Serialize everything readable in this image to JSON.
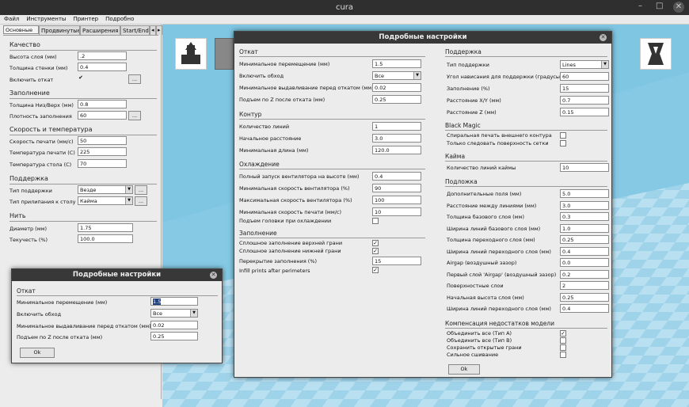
{
  "window": {
    "title": "cura",
    "min": "–",
    "max": "□",
    "close": "✕"
  },
  "menu": [
    "Файл",
    "Инструменты",
    "Принтер",
    "Подробно"
  ],
  "tabs": [
    "Основные",
    "Продвинутые",
    "Расширения",
    "Start/End"
  ],
  "left": {
    "quality": {
      "title": "Качество",
      "layer": "Высота слоя (мм)",
      "layer_v": ".2",
      "wall": "Толщина стенки (мм)",
      "wall_v": "0.4",
      "retract": "Включить откат",
      "retract_v": "✔",
      "more": "..."
    },
    "fill": {
      "title": "Заполнение",
      "topbot": "Толщина Низ/Верх (мм)",
      "topbot_v": "0.8",
      "density": "Плотность заполнения",
      "density_v": "60",
      "more": "..."
    },
    "speed": {
      "title": "Скорость и температура",
      "speed": "Скорость печати (мм/с)",
      "speed_v": "50",
      "temp": "Температура печати (С)",
      "temp_v": "225",
      "bed": "Температура стола (С)",
      "bed_v": "70"
    },
    "support": {
      "title": "Поддержка",
      "type": "Тип поддержки",
      "type_v": "Везде",
      "adh": "Тип прилипания к столу",
      "adh_v": "Кайма",
      "more": "..."
    },
    "fil": {
      "title": "Нить",
      "diam": "Диаметр (мм)",
      "diam_v": "1.75",
      "flow": "Текучесть (%)",
      "flow_v": "100.0"
    }
  },
  "small": {
    "title": "Подробные настройки",
    "sec": "Откат",
    "minmove": "Минимальное перемещение (мм)",
    "minmove_v": "1.5",
    "comb": "Включить обход",
    "comb_v": "Все",
    "minext": "Минимальное выдавливание перед откатом (мм)",
    "minext_v": "0.02",
    "zhop": "Подъем по Z после отката (мм)",
    "zhop_v": "0.25",
    "ok": "Ok"
  },
  "big": {
    "title": "Подробные настройки",
    "ok": "Ok",
    "retract": {
      "title": "Откат",
      "minmove": "Минимальное перемещение (мм)",
      "minmove_v": "1.5",
      "comb": "Включить обход",
      "comb_v": "Все",
      "minext": "Минимальное выдавливание перед откатом (мм)",
      "minext_v": "0.02",
      "zhop": "Подъем по Z после отката (мм)",
      "zhop_v": "0.25"
    },
    "contour": {
      "title": "Контур",
      "lines": "Количество линий",
      "lines_v": "1",
      "dist": "Начальное расстояние",
      "dist_v": "3.0",
      "minlen": "Минимальная длина (мм)",
      "minlen_v": "120.0"
    },
    "cool": {
      "title": "Охлаждение",
      "full": "Полный запуск вентилятора на высоте (мм)",
      "full_v": "0.4",
      "fmin": "Минимальная скорость вентилятора (%)",
      "fmin_v": "90",
      "fmax": "Максимальная скорость вентилятора (%)",
      "fmax_v": "100",
      "minspeed": "Минимальная скорость печати (мм/с)",
      "minspeed_v": "10",
      "lift": "Подъем головки при охлаждении"
    },
    "fill": {
      "title": "Заполнение",
      "top": "Сплошное заполнение верхней грани",
      "bot": "Сплошное заполнение нижней грани",
      "overlap": "Перекрытие заполнения (%)",
      "overlap_v": "15",
      "after": "Infill prints after perimeters"
    },
    "support": {
      "title": "Поддержка",
      "type": "Тип поддержки",
      "type_v": "Lines",
      "angle": "Угол нависания для поддержки (градусы)",
      "angle_v": "60",
      "fill": "Заполнение (%)",
      "fill_v": "15",
      "xy": "Расстояние X/Y (мм)",
      "xy_v": "0.7",
      "z": "Расстояние Z (мм)",
      "z_v": "0.15"
    },
    "black": {
      "title": "Black Magic",
      "spiral": "Спиральная печать внешнего контура",
      "surface": "Только следовать поверхность сетки"
    },
    "brim": {
      "title": "Кайма",
      "lines": "Количество линий каймы",
      "lines_v": "10"
    },
    "raft": {
      "title": "Подложка",
      "margin": "Дополнительные поля (мм)",
      "margin_v": "5.0",
      "spacing": "Расстояние между линиями (мм)",
      "spacing_v": "3.0",
      "base": "Толщина базового слоя (мм)",
      "base_v": "0.3",
      "basew": "Ширина линий базового слоя (мм)",
      "basew_v": "1.0",
      "inter": "Толщина переходного слоя (мм)",
      "inter_v": "0.25",
      "interw": "Ширина линий переходного слоя (мм)",
      "interw_v": "0.4",
      "airgap": "Airgap (воздушный зазор)",
      "airgap_v": "0.0",
      "first": "Первый слой 'Airgap' (воздушный зазор)",
      "first_v": "0.2",
      "surf": "Поверхностные слои",
      "surf_v": "2",
      "inith": "Начальная высота слоя (мм)",
      "inith_v": "0.25",
      "transw": "Ширина линий переходного слоя (мм)",
      "transw_v": "0.4"
    },
    "fix": {
      "title": "Компенсация недостатков модели",
      "a": "Объединить все (Тип A)",
      "b": "Объединить все (Тип B)",
      "open": "Сохранить открытые грани",
      "stitch": "Сильное сшивание"
    }
  },
  "colors": {
    "viewport": "#7fc6e2",
    "titlebar": "#2f2f2f"
  }
}
